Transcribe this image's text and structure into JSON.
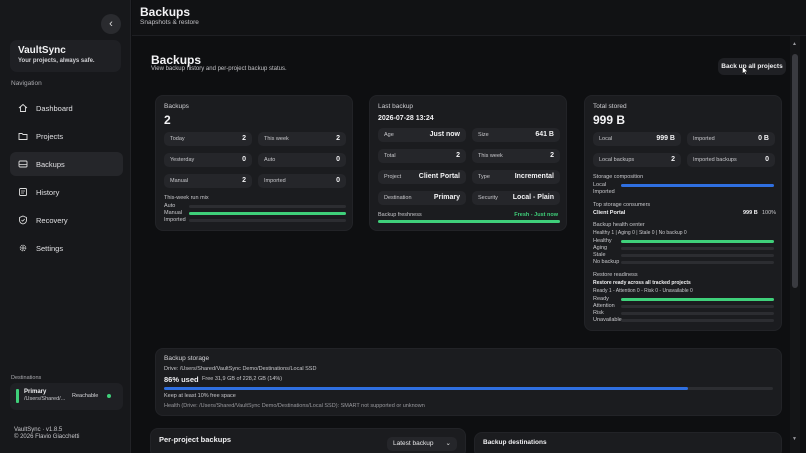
{
  "app": {
    "name": "VaultSync",
    "tagline": "Your projects, always safe.",
    "version": "VaultSync · v1.8.5",
    "copyright": "© 2026 Flavio Giacchetti"
  },
  "nav": {
    "title": "Navigation",
    "items": [
      {
        "label": "Dashboard",
        "icon": "home-icon"
      },
      {
        "label": "Projects",
        "icon": "folder-icon"
      },
      {
        "label": "Backups",
        "icon": "drive-icon"
      },
      {
        "label": "History",
        "icon": "history-icon"
      },
      {
        "label": "Recovery",
        "icon": "shield-icon"
      },
      {
        "label": "Settings",
        "icon": "gear-icon"
      }
    ],
    "active": "Backups"
  },
  "destinations": {
    "title": "Destinations",
    "primary": {
      "name": "Primary",
      "path": "/Users/Shared/...",
      "status": "Reachable"
    }
  },
  "header": {
    "title": "Backups",
    "subtitle": "Snapshots & restore"
  },
  "page": {
    "title": "Backups",
    "subtitle": "View backup history and per-project backup status.",
    "backup_all_label": "Back up all projects"
  },
  "backups_card": {
    "label": "Backups",
    "value": "2",
    "stats": [
      {
        "k": "Today",
        "v": "2"
      },
      {
        "k": "This week",
        "v": "2"
      },
      {
        "k": "Yesterday",
        "v": "0"
      },
      {
        "k": "Auto",
        "v": "0"
      },
      {
        "k": "Manual",
        "v": "2"
      },
      {
        "k": "Imported",
        "v": "0"
      }
    ],
    "mix_title": "This-week run mix",
    "mix": [
      {
        "label": "Auto",
        "fraction": 0
      },
      {
        "label": "Manual",
        "fraction": 1
      },
      {
        "label": "Imported",
        "fraction": 0
      }
    ]
  },
  "last_backup": {
    "label": "Last backup",
    "value": "2026-07-28 13:24",
    "stats": [
      {
        "k": "Age",
        "v": "Just now"
      },
      {
        "k": "Size",
        "v": "641 B"
      },
      {
        "k": "Total",
        "v": "2"
      },
      {
        "k": "This week",
        "v": "2"
      },
      {
        "k": "Project",
        "v": "Client Portal"
      },
      {
        "k": "Type",
        "v": "Incremental"
      },
      {
        "k": "Destination",
        "v": "Primary"
      },
      {
        "k": "Security",
        "v": "Local - Plain"
      }
    ],
    "freshness_label": "Backup freshness",
    "freshness_value": "Fresh - Just now",
    "freshness_fraction": 1
  },
  "total_stored": {
    "label": "Total stored",
    "value": "999 B",
    "stats": [
      {
        "k": "Local",
        "v": "999 B"
      },
      {
        "k": "Imported",
        "v": "0 B"
      },
      {
        "k": "Local backups",
        "v": "2"
      },
      {
        "k": "Imported backups",
        "v": "0"
      }
    ],
    "composition_title": "Storage composition",
    "composition": [
      {
        "label": "Local",
        "fraction": 1
      },
      {
        "label": "Imported",
        "fraction": 0
      }
    ],
    "consumers_title": "Top storage consumers",
    "consumer": {
      "name": "Client Portal",
      "size": "999 B",
      "percent": "100%"
    },
    "health_title": "Backup health center",
    "health_summary": "Healthy 1 | Aging 0 | Stale 0 | No backup 0",
    "health": [
      {
        "label": "Healthy",
        "fraction": 1
      },
      {
        "label": "Aging",
        "fraction": 0
      },
      {
        "label": "Stale",
        "fraction": 0
      },
      {
        "label": "No backup",
        "fraction": 0
      }
    ],
    "restore_title": "Restore readiness",
    "restore_headline": "Restore ready across all tracked projects",
    "restore_summary": "Ready 1 - Attention 0 - Risk 0 - Unavailable 0",
    "restore": [
      {
        "label": "Ready",
        "fraction": 1
      },
      {
        "label": "Attention",
        "fraction": 0
      },
      {
        "label": "Risk",
        "fraction": 0
      },
      {
        "label": "Unavailable",
        "fraction": 0
      }
    ]
  },
  "storage": {
    "title": "Backup storage",
    "drive": "Drive: /Users/Shared/VaultSync Demo/Destinations/Local SSD",
    "used": "86% used",
    "free": "Free 31,9 GB of 228,2 GB (14%)",
    "used_fraction": 0.86,
    "hint": "Keep at least 10% free space",
    "health": "Health (Drive: /Users/Shared/VaultSync Demo/Destinations/Local SSD): SMART not supported or unknown"
  },
  "per_project": {
    "title": "Per-project backups",
    "sort": "Latest backup"
  },
  "backup_destinations": {
    "title": "Backup destinations"
  },
  "colors": {
    "accent": "#3fd07a",
    "storage_bar": "#2f6fe0",
    "background": "#0e0f11",
    "card": "#1b1c1f"
  }
}
